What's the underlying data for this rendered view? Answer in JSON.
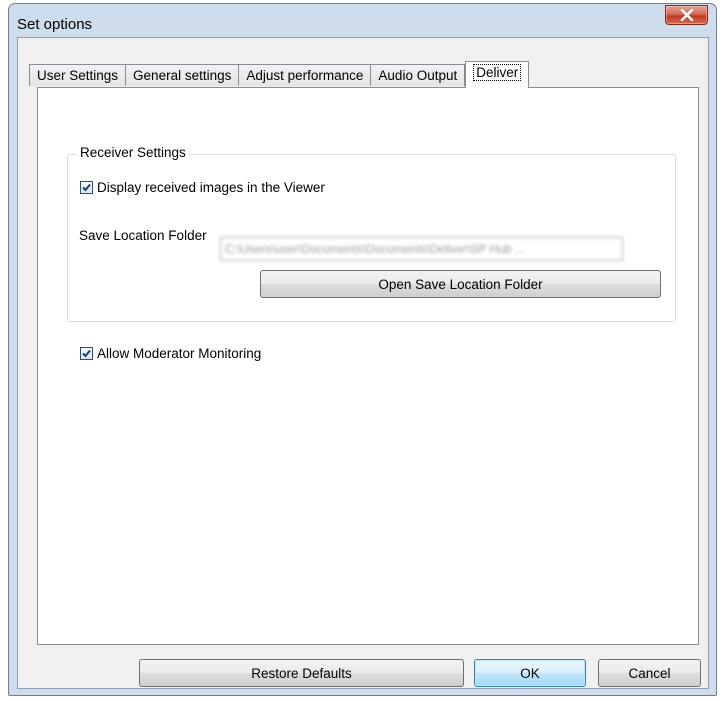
{
  "window": {
    "title": "Set options"
  },
  "tabs": [
    {
      "label": "User Settings"
    },
    {
      "label": "General settings"
    },
    {
      "label": "Adjust performance"
    },
    {
      "label": "Audio Output"
    },
    {
      "label": "Deliver",
      "active": true
    }
  ],
  "receiver": {
    "group_title": "Receiver Settings",
    "display_images": {
      "label": "Display received images in the Viewer",
      "checked": true
    },
    "save_location": {
      "label": "Save Location Folder",
      "value": "C:\\Users\\user\\Documents\\Documents\\Deliver\\SP Hub ..."
    },
    "open_folder_button": "Open Save Location Folder"
  },
  "moderator": {
    "label": "Allow Moderator Monitoring",
    "checked": true
  },
  "footer": {
    "restore_defaults": "Restore Defaults",
    "ok": "OK",
    "cancel": "Cancel"
  },
  "colors": {
    "accent": "#3c7fb1",
    "close": "#c03a22"
  },
  "icons": {
    "close": "close-icon",
    "check": "checkmark-icon"
  }
}
